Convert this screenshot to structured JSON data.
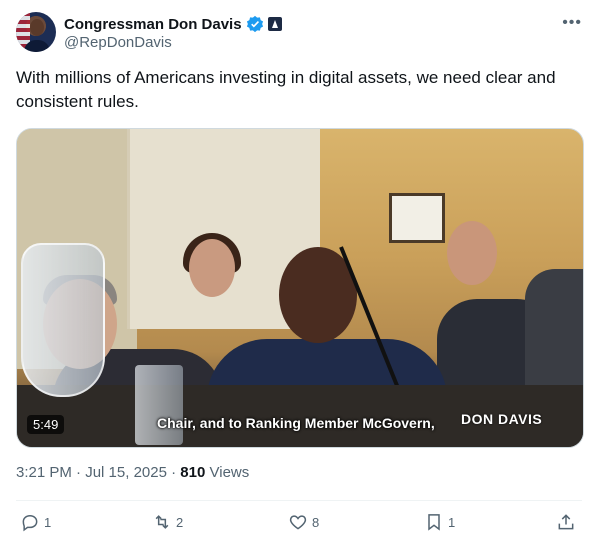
{
  "author": {
    "display_name": "Congressman Don Davis",
    "handle": "@RepDonDavis",
    "avatar_icon": "avatar",
    "verified_color": "#1d9bf0",
    "gov_badge_icon": "government-badge-icon"
  },
  "more_icon": "more-icon",
  "tweet": {
    "text": "With millions of Americans investing in digital assets, we need clear and consistent rules."
  },
  "media": {
    "duration": "5:49",
    "caption": "Chair, and to Ranking Member McGovern,",
    "watermark": "DON DAVIS"
  },
  "meta": {
    "time": "3:21 PM",
    "separator": "·",
    "date": "Jul 15, 2025",
    "views_count": "810",
    "views_label": "Views"
  },
  "actions": {
    "reply_count": "1",
    "repost_count": "2",
    "like_count": "8",
    "bookmark_count": "1"
  }
}
